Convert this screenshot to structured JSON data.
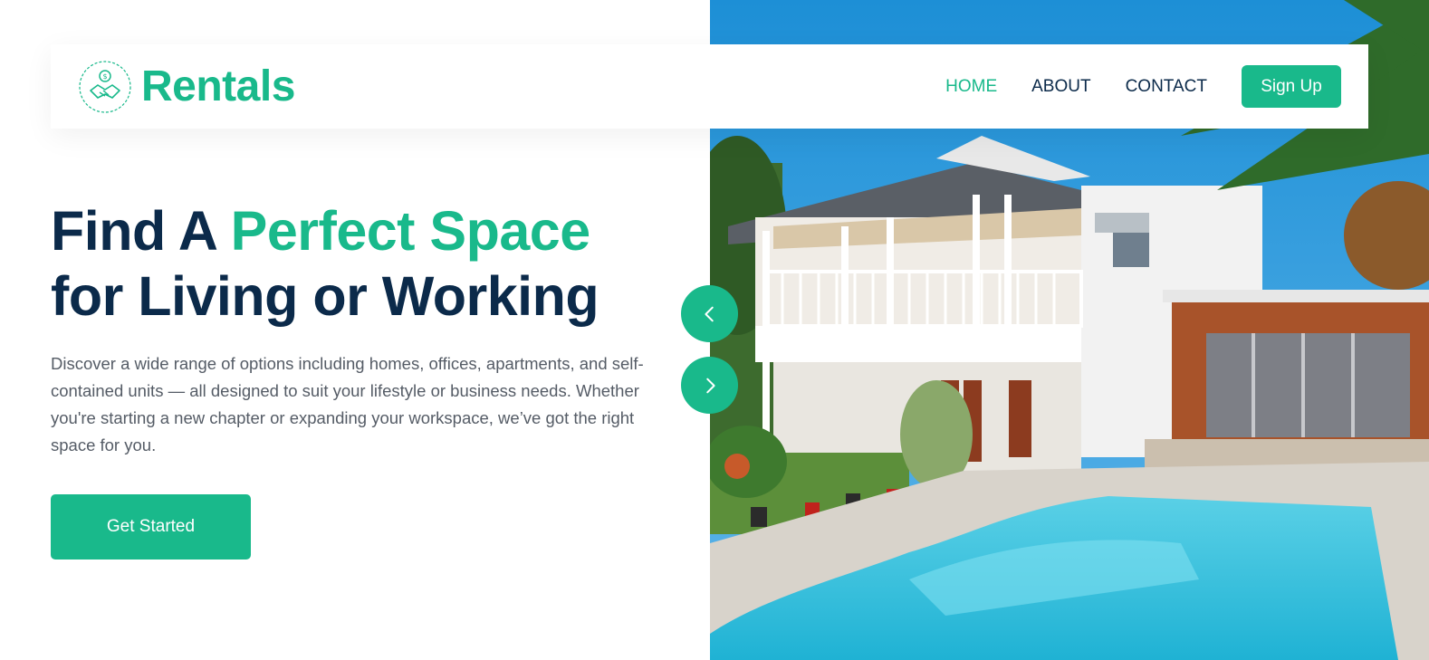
{
  "header": {
    "brand_name": "Rentals",
    "logo_icon": "handshake-icon",
    "nav": [
      {
        "label": "HOME",
        "active": true
      },
      {
        "label": "ABOUT",
        "active": false
      },
      {
        "label": "CONTACT",
        "active": false
      }
    ],
    "signup_label": "Sign Up"
  },
  "hero": {
    "title_part1": "Find A ",
    "title_accent": "Perfect Space",
    "title_part2": "for Living or Working",
    "description": "Discover a wide range of options including homes, offices, apartments, and self-contained units — all designed to suit your lifestyle or business needs. Whether you're starting a new chapter or expanding your workspace, we’ve got the right space for you.",
    "cta_label": "Get Started",
    "image": "house-with-pool-photo",
    "prev_icon": "chevron-left-icon",
    "next_icon": "chevron-right-icon"
  },
  "colors": {
    "accent": "#19b98b",
    "navy": "#0b2a4a",
    "body_text": "#555c66"
  }
}
